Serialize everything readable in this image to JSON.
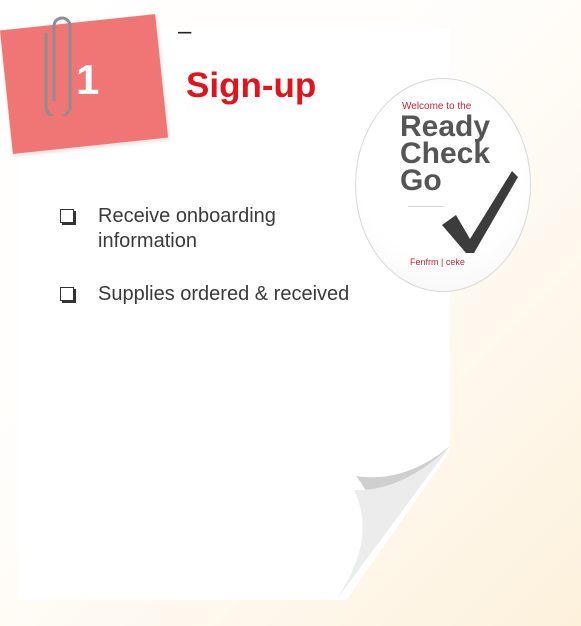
{
  "step": {
    "number": "1",
    "title": "Sign-up",
    "dash": "–"
  },
  "checklist": [
    {
      "text": "Receive onboarding information",
      "checked": false
    },
    {
      "text": "Supplies ordered & received",
      "checked": false
    }
  ],
  "badge": {
    "tagline": "Welcome to the",
    "line1": "Ready",
    "line2": "Check",
    "line3": "Go",
    "footer": "Fenfrm | ceke"
  },
  "colors": {
    "accent": "#e2141b",
    "note": "#f07575",
    "text": "#3a3a3a"
  },
  "icons": [
    "paperclip-icon",
    "checkbox-icon",
    "checkmark-icon"
  ]
}
